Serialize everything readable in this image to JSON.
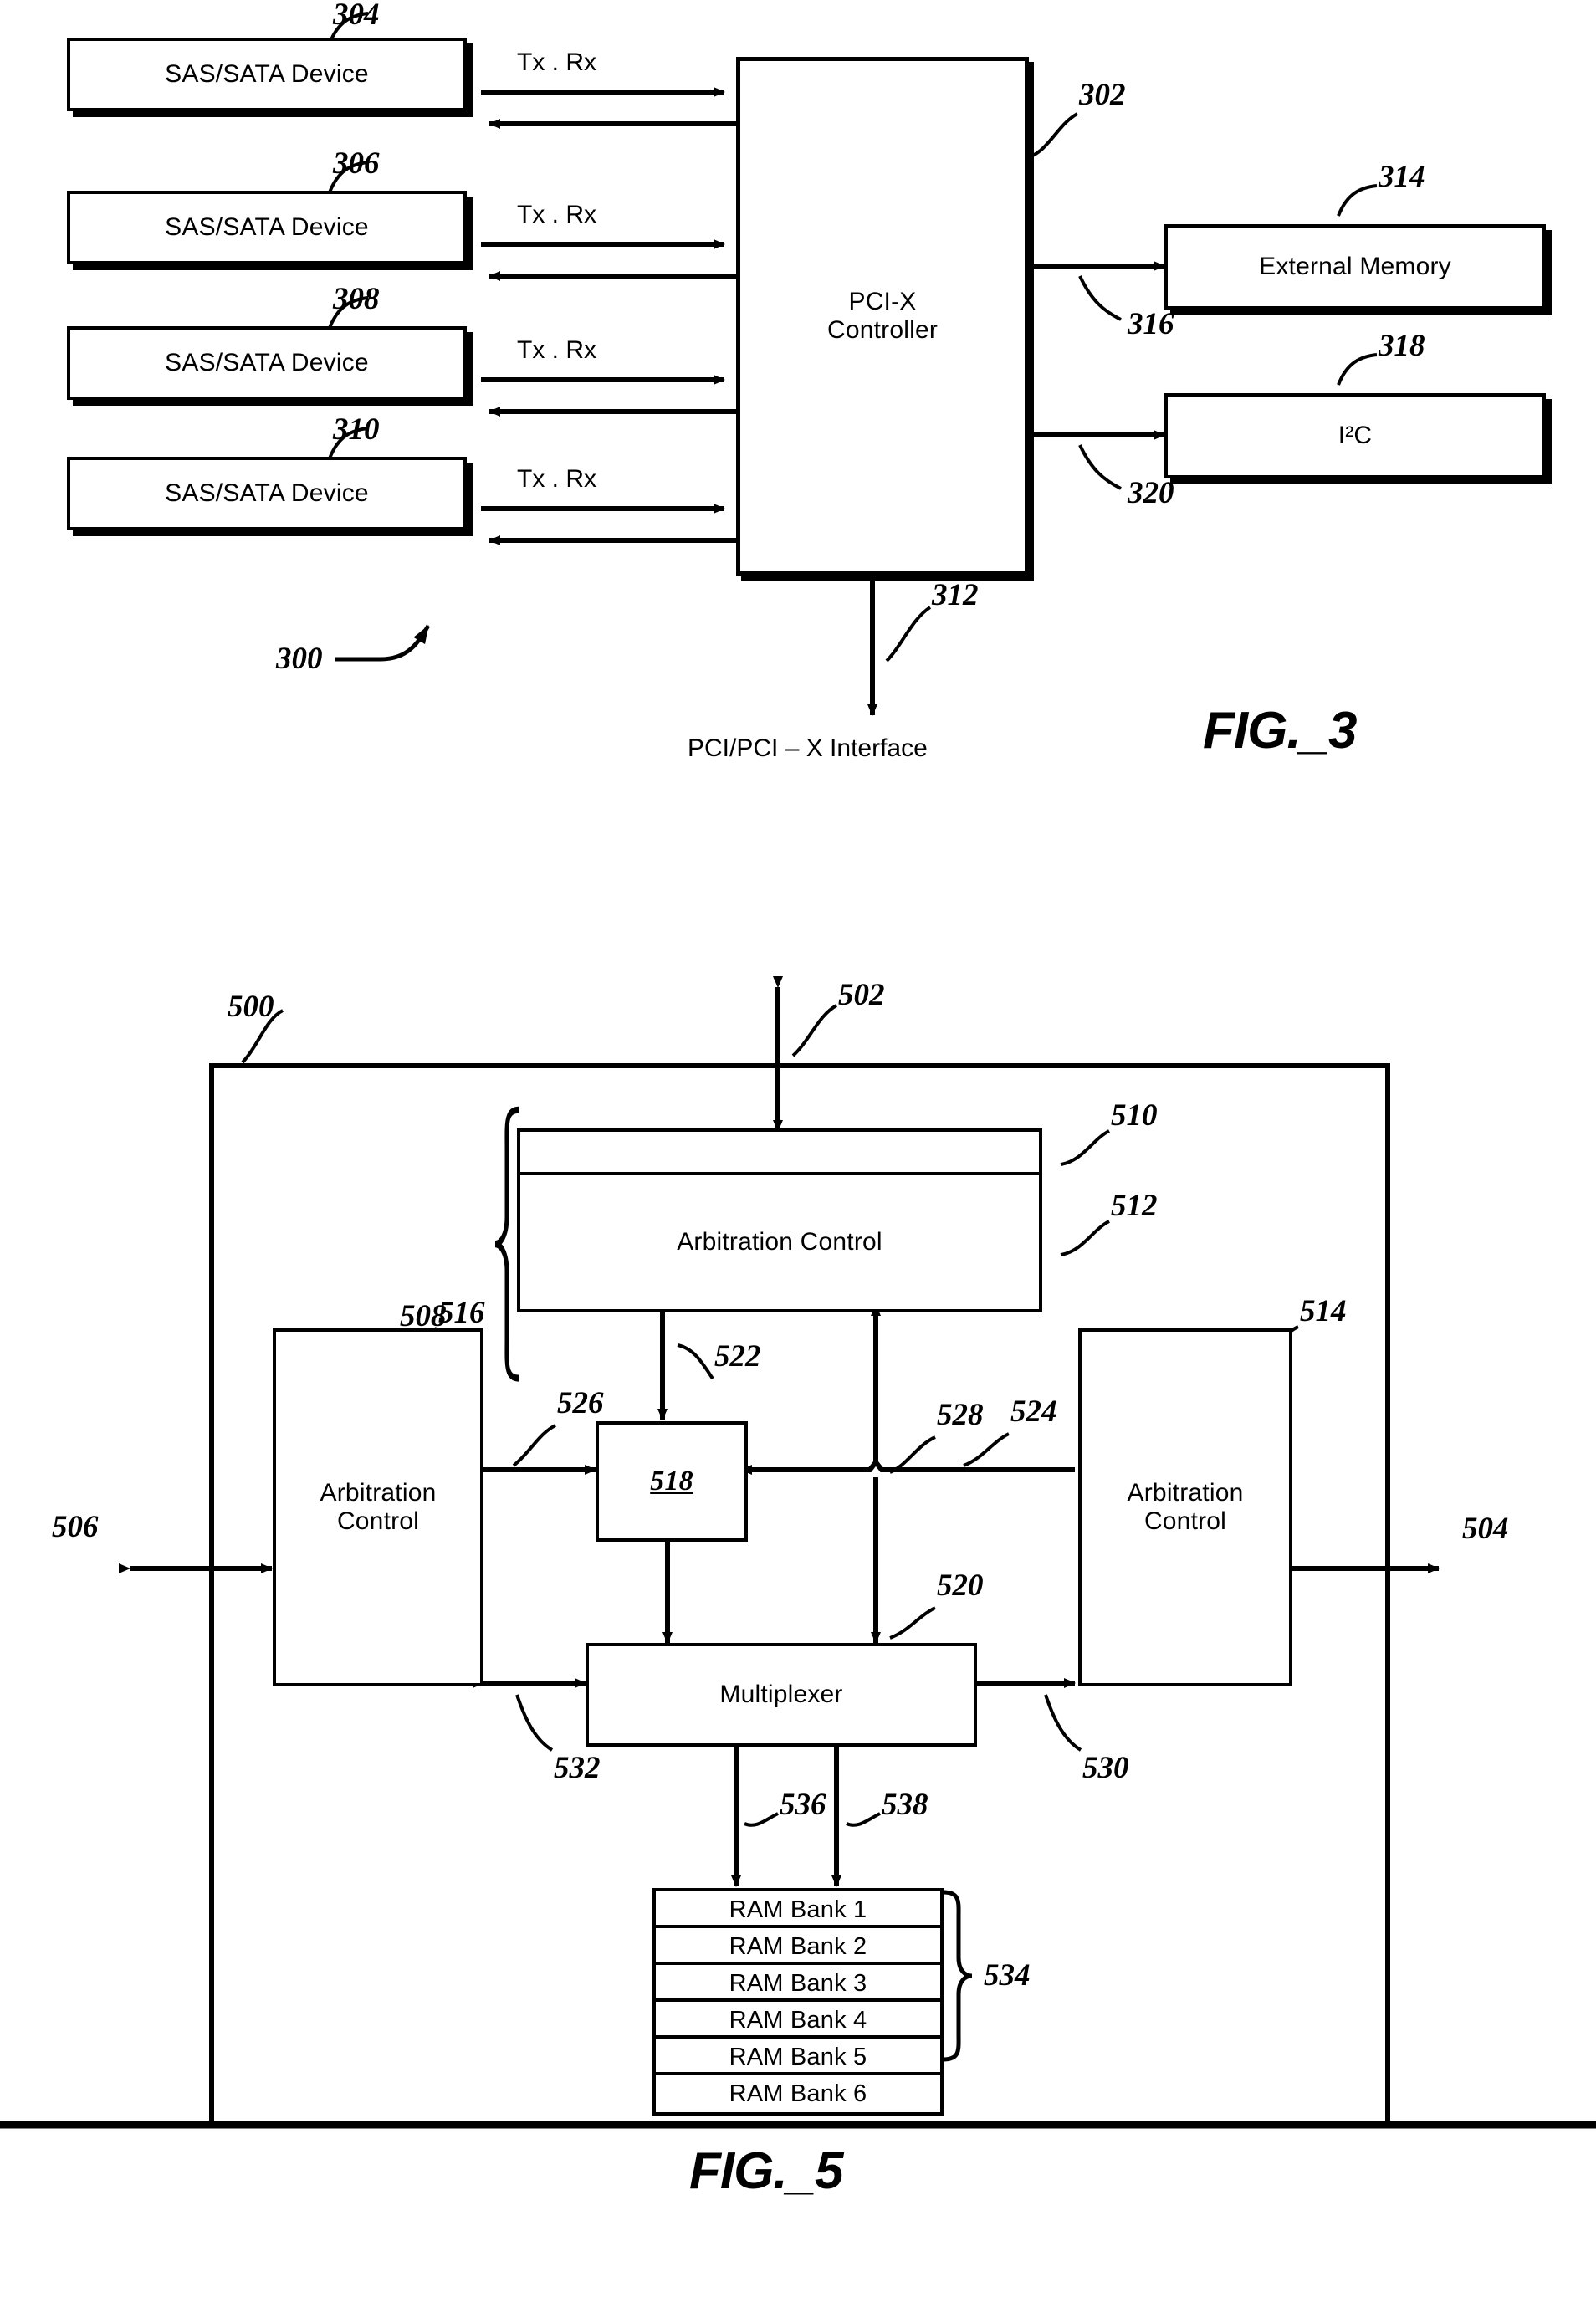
{
  "figures": [
    {
      "id": "fig3",
      "caption": "FIG._3",
      "system_ref": "300",
      "controller": {
        "label": "PCI-X\nController",
        "ref": "302"
      },
      "devices": [
        {
          "label": "SAS/SATA Device",
          "ref": "304",
          "link_label": "Tx . Rx"
        },
        {
          "label": "SAS/SATA Device",
          "ref": "306",
          "link_label": "Tx . Rx"
        },
        {
          "label": "SAS/SATA Device",
          "ref": "308",
          "link_label": "Tx . Rx"
        },
        {
          "label": "SAS/SATA Device",
          "ref": "310",
          "link_label": "Tx . Rx"
        }
      ],
      "peripherals": [
        {
          "label": "External Memory",
          "ref": "314",
          "bus_ref": "316"
        },
        {
          "label": "I²C",
          "ref": "318",
          "bus_ref": "320"
        }
      ],
      "host_bus": {
        "ref": "312",
        "label": "PCI/PCI – X Interface"
      }
    },
    {
      "id": "fig5",
      "caption": "FIG._5",
      "system_ref": "500",
      "ports": [
        {
          "ref": "502",
          "position": "top"
        },
        {
          "ref": "504",
          "position": "right"
        },
        {
          "ref": "506",
          "position": "left"
        }
      ],
      "blocks": [
        {
          "name": "top-arbitration-control",
          "label": "Arbitration Control",
          "ref": "512",
          "group_ref": "508",
          "strip_ref": "510"
        },
        {
          "name": "left-arbitration-control",
          "label": "Arbitration\nControl",
          "ref": "516"
        },
        {
          "name": "right-arbitration-control",
          "label": "Arbitration\nControl",
          "ref": "514"
        },
        {
          "name": "register-block",
          "label": "518",
          "ref": "518"
        },
        {
          "name": "multiplexer",
          "label": "Multiplexer",
          "ref": "520"
        }
      ],
      "ram": {
        "group_ref": "534",
        "banks": [
          "RAM Bank 1",
          "RAM Bank 2",
          "RAM Bank 3",
          "RAM Bank 4",
          "RAM Bank 5",
          "RAM Bank 6"
        ]
      },
      "connection_refs": [
        "522",
        "524",
        "526",
        "528",
        "530",
        "532",
        "536",
        "538"
      ]
    }
  ],
  "fig3": {
    "caption": "FIG._3",
    "ref_300": "300",
    "ref_302": "302",
    "ref_304": "304",
    "ref_306": "306",
    "ref_308": "308",
    "ref_310": "310",
    "ref_312": "312",
    "ref_314": "314",
    "ref_316": "316",
    "ref_318": "318",
    "ref_320": "320",
    "device_label": "SAS/SATA Device",
    "txrx": "Tx . Rx",
    "controller_line1": "PCI-X",
    "controller_line2": "Controller",
    "external_memory": "External Memory",
    "i2c": "I²C",
    "host_interface": "PCI/PCI – X Interface"
  },
  "fig5": {
    "caption": "FIG._5",
    "ref_500": "500",
    "ref_502": "502",
    "ref_504": "504",
    "ref_506": "506",
    "ref_508": "508",
    "ref_510": "510",
    "ref_512": "512",
    "ref_514": "514",
    "ref_516": "516",
    "ref_518": "518",
    "ref_520": "520",
    "ref_522": "522",
    "ref_524": "524",
    "ref_526": "526",
    "ref_528": "528",
    "ref_530": "530",
    "ref_532": "532",
    "ref_534": "534",
    "ref_536": "536",
    "ref_538": "538",
    "arbitration_control": "Arbitration Control",
    "arbitration_line1": "Arbitration",
    "arbitration_line2": "Control",
    "multiplexer": "Multiplexer",
    "bank1": "RAM Bank 1",
    "bank2": "RAM Bank 2",
    "bank3": "RAM Bank 3",
    "bank4": "RAM Bank 4",
    "bank5": "RAM Bank 5",
    "bank6": "RAM Bank 6"
  },
  "colors": {
    "ink": "#000000",
    "paper": "#ffffff"
  }
}
